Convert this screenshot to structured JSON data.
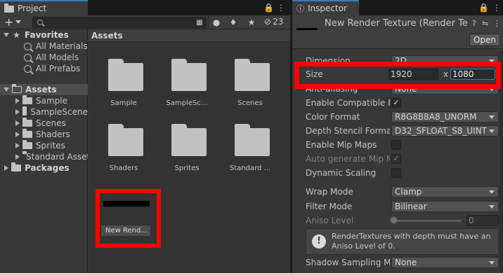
{
  "project": {
    "tab_title": "Project",
    "search": {
      "value": "",
      "placeholder": ""
    },
    "hidden_count": "23",
    "tree": {
      "favorites_label": "Favorites",
      "favorites": [
        "All Materials",
        "All Models",
        "All Prefabs"
      ],
      "assets_label": "Assets",
      "assets_children": [
        "Sample",
        "SampleScene",
        "Scenes",
        "Shaders",
        "Sprites",
        "Standard Assets"
      ],
      "packages_label": "Packages"
    },
    "breadcrumb": "Assets",
    "items": [
      "Sample",
      "SampleSc...",
      "Scenes",
      "Shaders",
      "Sprites",
      "Standard ..."
    ],
    "render_texture_label": "New Rend..."
  },
  "inspector": {
    "tab_title": "Inspector",
    "object_title": "New Render Texture (Render Te",
    "open_label": "Open",
    "dimension": {
      "label": "Dimension",
      "value": "2D"
    },
    "size": {
      "label": "Size",
      "width": "1920",
      "separator": "x",
      "height": "1080"
    },
    "anti_aliasing": {
      "label": "Anti-aliasing",
      "value": "None"
    },
    "enable_compatible": {
      "label": "Enable Compatible Fo",
      "checked": true
    },
    "color_format": {
      "label": "Color Format",
      "value": "R8G8B8A8_UNORM"
    },
    "depth_stencil": {
      "label": "Depth Stencil Format",
      "value": "D32_SFLOAT_S8_UINT"
    },
    "mip_maps": {
      "label": "Enable Mip Maps",
      "checked": false
    },
    "auto_mip": {
      "label": "Auto generate Mip Ma",
      "checked": true
    },
    "dynamic_scaling": {
      "label": "Dynamic Scaling",
      "checked": false
    },
    "wrap_mode": {
      "label": "Wrap Mode",
      "value": "Clamp"
    },
    "filter_mode": {
      "label": "Filter Mode",
      "value": "Bilinear"
    },
    "aniso_level": {
      "label": "Aniso Level",
      "value": "0"
    },
    "help_text": "RenderTextures with depth must have an Aniso Level of 0.",
    "shadow_sampling": {
      "label": "Shadow Sampling Mo",
      "value": "None"
    }
  },
  "colors": {
    "highlight": "#ff0000",
    "accent": "#3a79bb"
  },
  "icons": [
    "folder-icon",
    "star-icon",
    "search-icon",
    "lock-icon",
    "menu-icon",
    "help-icon",
    "settings-icon",
    "eye-icon",
    "tag-icon"
  ]
}
